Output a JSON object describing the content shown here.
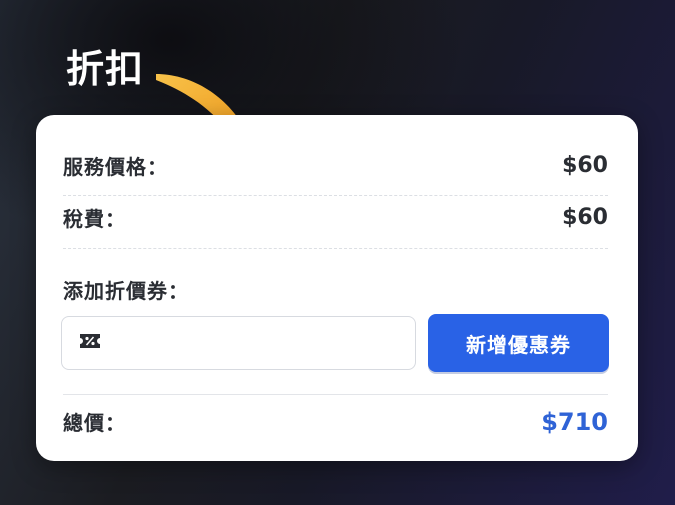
{
  "heading": "折扣",
  "summary": {
    "service_price_label": "服務價格：",
    "service_price_value": "$60",
    "tax_label": "稅費：",
    "tax_value": "$60"
  },
  "coupon": {
    "section_label": "添加折價券：",
    "input_value": "",
    "input_placeholder": "",
    "icon": "coupon-ticket-icon",
    "add_button_label": "新增優惠券"
  },
  "total": {
    "label": "總價：",
    "value": "$710"
  },
  "colors": {
    "accent": "#2962e6",
    "total_value": "#2f63d6",
    "arrow": "#f2a51c",
    "card_bg": "#ffffff"
  }
}
